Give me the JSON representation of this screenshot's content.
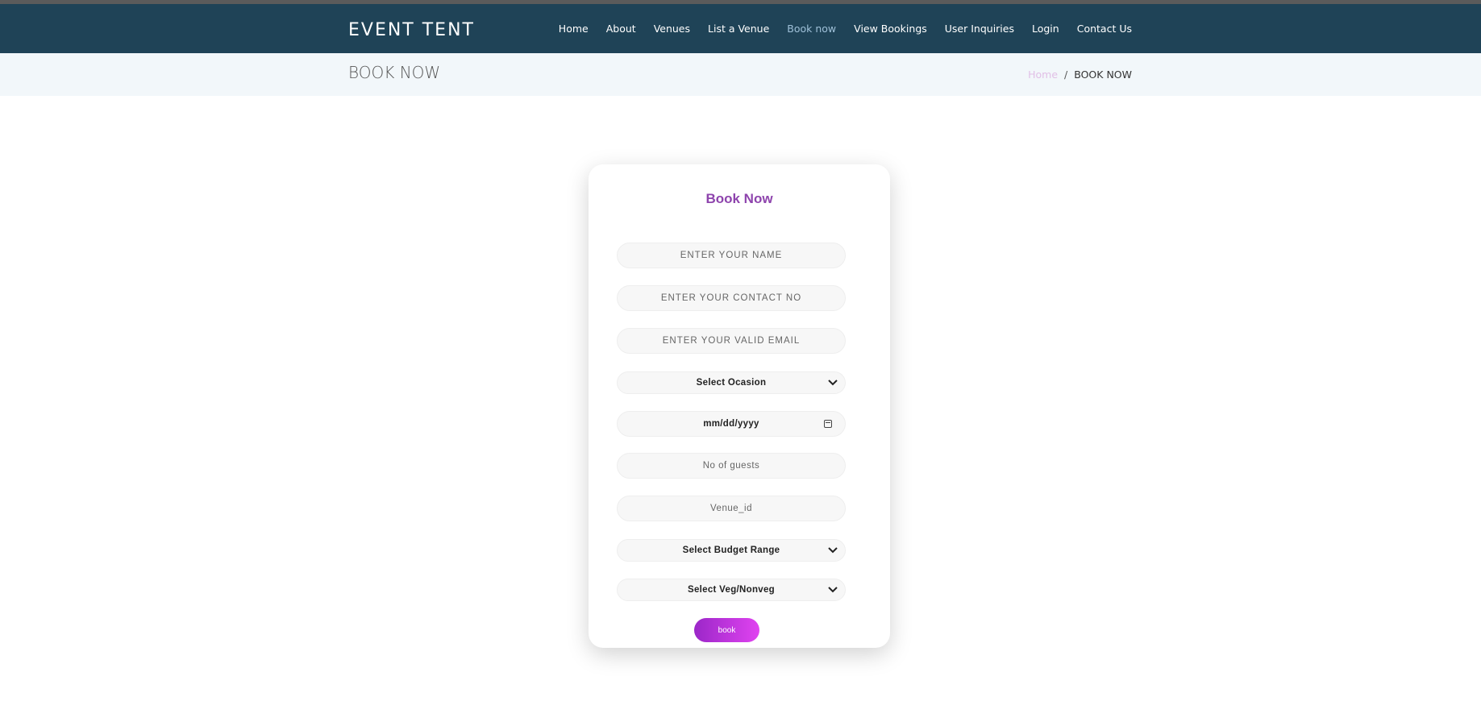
{
  "brand": "EVENT TENT",
  "nav": [
    {
      "label": "Home"
    },
    {
      "label": "About"
    },
    {
      "label": "Venues"
    },
    {
      "label": "List a Venue"
    },
    {
      "label": "Book now",
      "active": true
    },
    {
      "label": "View Bookings"
    },
    {
      "label": "User Inquiries"
    },
    {
      "label": "Login"
    },
    {
      "label": "Contact Us"
    }
  ],
  "page": {
    "heading": "BOOK NOW",
    "breadcrumb": {
      "home": "Home",
      "separator": "/",
      "current": "BOOK NOW"
    }
  },
  "form": {
    "title": "Book Now",
    "name_placeholder": "ENTER YOUR NAME",
    "contact_placeholder": "ENTER YOUR CONTACT NO",
    "email_placeholder": "ENTER YOUR VALID EMAIL",
    "occasion_value": "Select Ocasion",
    "date_value": "mm/dd/yyyy",
    "guests_placeholder": "No of guests",
    "venue_placeholder": "Venue_id",
    "budget_value": "Select Budget Range",
    "veg_value": "Select Veg/Nonveg",
    "submit_label": "book"
  },
  "colors": {
    "navbar": "#1f4357",
    "accent": "#8e44ad",
    "button_start": "#9b27c8",
    "button_end": "#e043f0"
  },
  "icons": {
    "select": "chevron-down-icon",
    "date": "calendar-icon"
  }
}
